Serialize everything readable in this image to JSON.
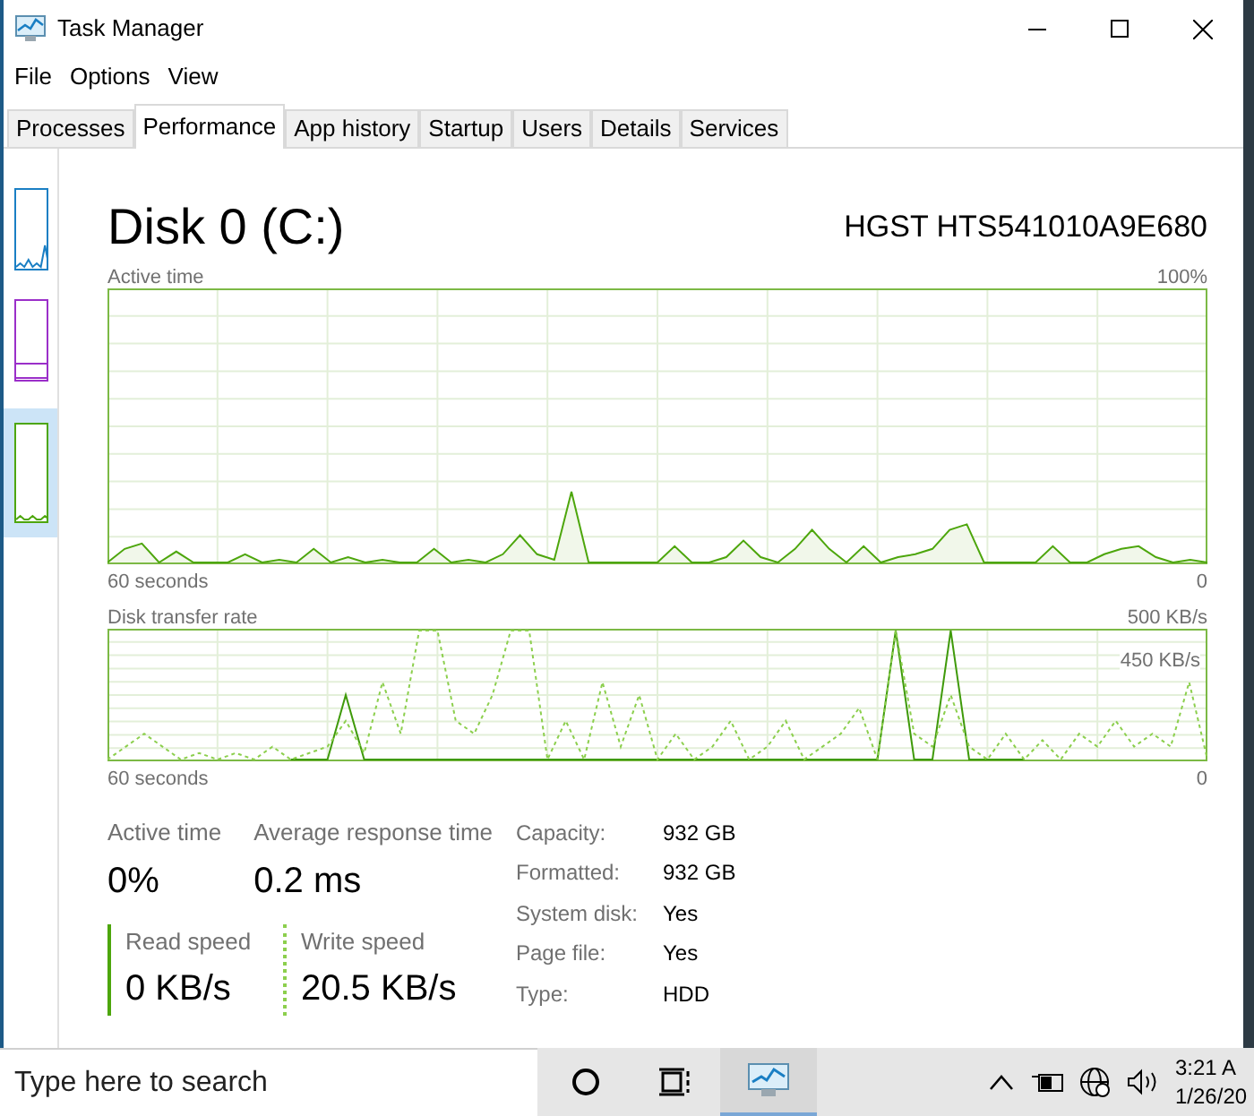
{
  "window": {
    "title": "Task Manager"
  },
  "menu": [
    "File",
    "Options",
    "View"
  ],
  "tabs": [
    {
      "label": "Processes",
      "selected": false
    },
    {
      "label": "Performance",
      "selected": true
    },
    {
      "label": "App history",
      "selected": false
    },
    {
      "label": "Startup",
      "selected": false
    },
    {
      "label": "Users",
      "selected": false
    },
    {
      "label": "Details",
      "selected": false
    },
    {
      "label": "Services",
      "selected": false
    }
  ],
  "sidebar": {
    "items": [
      {
        "color": "#1a7fc4",
        "selected": false
      },
      {
        "color": "#9b2fc9",
        "selected": false
      },
      {
        "color": "#4da60c",
        "selected": true
      }
    ]
  },
  "disk": {
    "title": "Disk 0 (C:)",
    "model": "HGST HTS541010A9E680",
    "active_graph": {
      "label": "Active time",
      "max": "100%",
      "time": "60 seconds",
      "min": "0"
    },
    "transfer_graph": {
      "label": "Disk transfer rate",
      "max": "500 KB/s",
      "scale": "450 KB/s",
      "time": "60 seconds",
      "min": "0"
    },
    "stats": [
      {
        "label": "Active time",
        "value": "0%"
      },
      {
        "label": "Average response time",
        "value": "0.2 ms"
      }
    ],
    "speeds": [
      {
        "kind": "read",
        "label": "Read speed",
        "value": "0 KB/s"
      },
      {
        "kind": "write",
        "label": "Write speed",
        "value": "20.5 KB/s"
      }
    ],
    "properties": [
      {
        "label": "Capacity:",
        "value": "932 GB"
      },
      {
        "label": "Formatted:",
        "value": "932 GB"
      },
      {
        "label": "System disk:",
        "value": "Yes"
      },
      {
        "label": "Page file:",
        "value": "Yes"
      },
      {
        "label": "Type:",
        "value": "HDD"
      }
    ]
  },
  "taskbar": {
    "search_placeholder": "Type here to search",
    "time": "3:21 A",
    "date": "1/26/20"
  }
}
